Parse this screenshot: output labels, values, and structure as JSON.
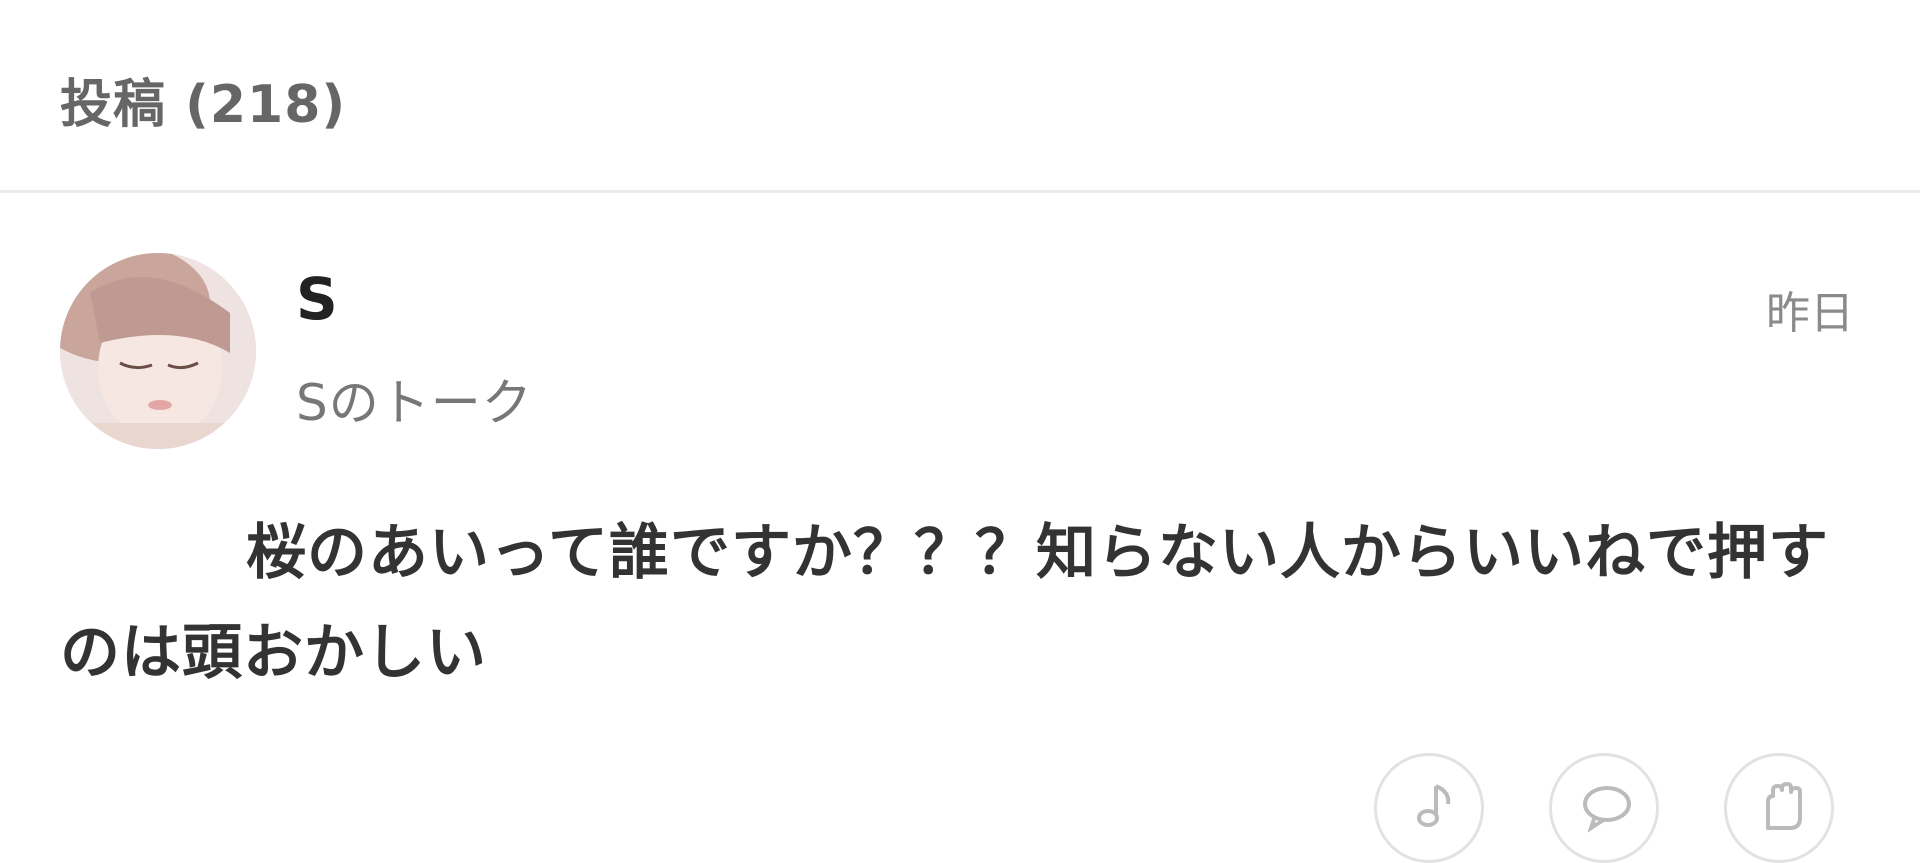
{
  "posts_section": {
    "title": "投稿 (218)"
  },
  "post": {
    "user_name": "S",
    "talk_name": "Sのトーク",
    "timestamp": "昨日",
    "body": "桜のあいって誰ですか？？？知らない人からいいねで押すのは頭おかしい"
  },
  "actions": [
    {
      "icon": "music-icon"
    },
    {
      "icon": "comment-icon"
    },
    {
      "icon": "hand-icon"
    }
  ],
  "colors": {
    "title_text": "#666666",
    "body_text": "#333333",
    "meta_text": "#8a8a8a",
    "divider": "#ebebeb"
  }
}
